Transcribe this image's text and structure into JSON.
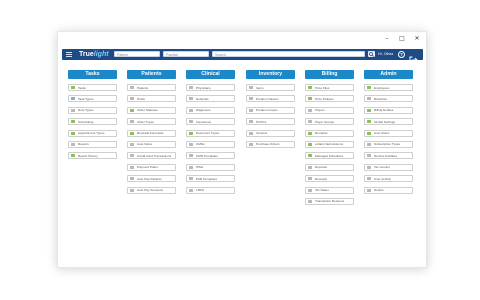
{
  "window": {
    "controls": [
      "–",
      "□",
      "✕"
    ]
  },
  "appbar": {
    "logo_prefix": "True",
    "logo_suffix": "light",
    "field1_placeholder": "Patient",
    "field2_placeholder": "Practice",
    "field3_placeholder": "Search",
    "user_label": "Hi, Olivia",
    "help_label": "?"
  },
  "columns": [
    {
      "title": "Tasks",
      "items": [
        {
          "label": "Tasks",
          "icon": "tasks-icon",
          "color": "#8bbf5a"
        },
        {
          "label": "Task Types",
          "icon": "task-types-icon",
          "color": "#7fb0d8"
        },
        {
          "label": "Note Types",
          "icon": "note-types-icon",
          "color": "#b8b8b8"
        },
        {
          "label": "Scheduling",
          "icon": "calendar-icon",
          "color": "#8bbf5a"
        },
        {
          "label": "Appointment Types",
          "icon": "appointment-icon",
          "color": "#8bbf5a"
        },
        {
          "label": "Reports",
          "icon": "reports-icon",
          "color": "#b8b8b8"
        },
        {
          "label": "Report History",
          "icon": "report-history-icon",
          "color": "#8bbf5a"
        }
      ]
    },
    {
      "title": "Patients",
      "items": [
        {
          "label": "Patients",
          "icon": "patients-icon",
          "color": "#b8b8b8"
        },
        {
          "label": "Holds",
          "icon": "holds-icon",
          "color": "#b8b8b8"
        },
        {
          "label": "Order Statuses",
          "icon": "order-status-icon",
          "color": "#8bbf5a"
        },
        {
          "label": "Order Types",
          "icon": "order-types-icon",
          "color": "#b8b8b8"
        },
        {
          "label": "Renewal Forecasts",
          "icon": "forecast-icon",
          "color": "#8bbf5a"
        },
        {
          "label": "Auto Notes",
          "icon": "auto-notes-icon",
          "color": "#b8b8b8"
        },
        {
          "label": "Credit Card Transactions",
          "icon": "credit-card-icon",
          "color": "#b8b8b8"
        },
        {
          "label": "Payment Plans",
          "icon": "payment-plans-icon",
          "color": "#b8b8b8"
        },
        {
          "label": "Auto Pay Patients",
          "icon": "auto-pay-icon",
          "color": "#b8b8b8"
        },
        {
          "label": "Auto Pay Sessions",
          "icon": "auto-pay-sessions-icon",
          "color": "#b8b8b8"
        }
      ]
    },
    {
      "title": "Clinical",
      "items": [
        {
          "label": "Physicians",
          "icon": "physicians-icon",
          "color": "#b8b8b8"
        },
        {
          "label": "Referrals",
          "icon": "referrals-icon",
          "color": "#b8b8b8"
        },
        {
          "label": "Diagnoses",
          "icon": "diagnoses-icon",
          "color": "#b8b8b8"
        },
        {
          "label": "Insurances",
          "icon": "insurances-icon",
          "color": "#b8b8b8"
        },
        {
          "label": "Document Types",
          "icon": "document-types-icon",
          "color": "#8bbf5a"
        },
        {
          "label": "CMNs",
          "icon": "cmn-icon",
          "color": "#b8b8b8"
        },
        {
          "label": "CMN Templates",
          "icon": "cmn-templates-icon",
          "color": "#b8b8b8"
        },
        {
          "label": "HIMs",
          "icon": "him-icon",
          "color": "#b8b8b8"
        },
        {
          "label": "PAR Templates",
          "icon": "par-templates-icon",
          "color": "#b8b8b8"
        },
        {
          "label": "LMNs",
          "icon": "lmn-icon",
          "color": "#b8b8b8"
        }
      ]
    },
    {
      "title": "Inventory",
      "items": [
        {
          "label": "Items",
          "icon": "items-icon",
          "color": "#b8b8b8"
        },
        {
          "label": "Product Classes",
          "icon": "product-classes-icon",
          "color": "#b8b8b8"
        },
        {
          "label": "Product Groups",
          "icon": "product-groups-icon",
          "color": "#b8b8b8"
        },
        {
          "label": "HCPCs",
          "icon": "hcpc-icon",
          "color": "#b8b8b8"
        },
        {
          "label": "Vendors",
          "icon": "vendors-icon",
          "color": "#b8b8b8"
        },
        {
          "label": "Purchase Orders",
          "icon": "purchase-orders-icon",
          "color": "#b8b8b8"
        }
      ]
    },
    {
      "title": "Billing",
      "items": [
        {
          "label": "Price Files",
          "icon": "price-files-icon",
          "color": "#8bbf5a"
        },
        {
          "label": "Price Policies",
          "icon": "price-policies-icon",
          "color": "#8bbf5a"
        },
        {
          "label": "Payers",
          "icon": "payers-icon",
          "color": "#b8b8b8"
        },
        {
          "label": "Payer Groups",
          "icon": "payer-groups-icon",
          "color": "#b8b8b8"
        },
        {
          "label": "Remarks",
          "icon": "remarks-icon",
          "color": "#8bbf5a"
        },
        {
          "label": "eClaim Submissions",
          "icon": "eclaim-icon",
          "color": "#8bbf5a"
        },
        {
          "label": "Managed Schedules",
          "icon": "schedules-icon",
          "color": "#8bbf5a"
        },
        {
          "label": "Deposits",
          "icon": "deposits-icon",
          "color": "#b8b8b8"
        },
        {
          "label": "Receipts",
          "icon": "receipts-icon",
          "color": "#b8b8b8"
        },
        {
          "label": "Tax Rates",
          "icon": "tax-rates-icon",
          "color": "#b8b8b8"
        },
        {
          "label": "Transaction Reasons",
          "icon": "transaction-reasons-icon",
          "color": "#b8b8b8"
        }
      ]
    },
    {
      "title": "Admin",
      "items": [
        {
          "label": "Employees",
          "icon": "employees-icon",
          "color": "#8bbf5a"
        },
        {
          "label": "Branches",
          "icon": "branches-icon",
          "color": "#b8b8b8"
        },
        {
          "label": "Billing Entities",
          "icon": "billing-entities-icon",
          "color": "#8bbf5a"
        },
        {
          "label": "Global Settings",
          "icon": "settings-icon",
          "color": "#8bbf5a"
        },
        {
          "label": "User Roles",
          "icon": "user-roles-icon",
          "color": "#8bbf5a"
        },
        {
          "label": "Subscription Types",
          "icon": "subscription-icon",
          "color": "#b8b8b8"
        },
        {
          "label": "Service Facilities",
          "icon": "facilities-icon",
          "color": "#b8b8b8"
        },
        {
          "label": "Tax Groups",
          "icon": "tax-groups-icon",
          "color": "#b8b8b8"
        },
        {
          "label": "User Activity",
          "icon": "activity-icon",
          "color": "#b8b8b8"
        },
        {
          "label": "Scripts",
          "icon": "scripts-icon",
          "color": "#b8b8b8"
        }
      ]
    }
  ]
}
